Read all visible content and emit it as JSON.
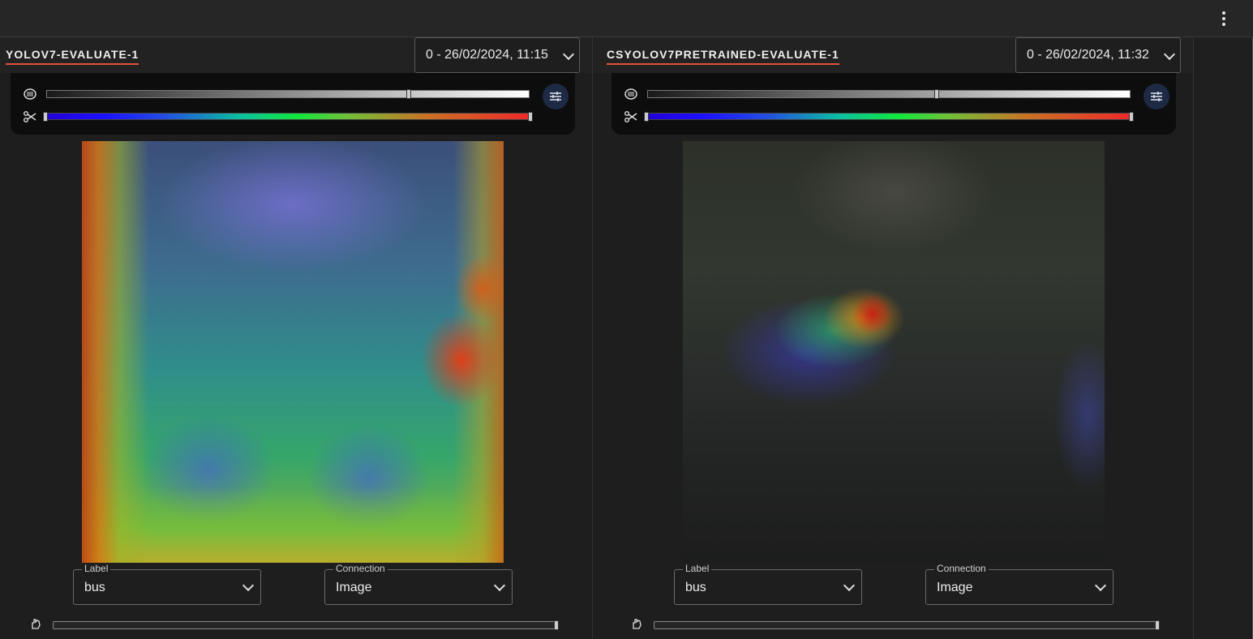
{
  "topbar": {
    "menu_icon": "more-vert-icon"
  },
  "panels": [
    {
      "title": "YOLOV7-EVALUATE-1",
      "run_selector": {
        "value": "0 - 26/02/2024, 11:15"
      },
      "opacity_slider": {
        "value_fraction": 0.75,
        "icon": "opacity-icon"
      },
      "threshold_slider": {
        "min_fraction": 0.0,
        "max_fraction": 1.0,
        "icon": "scissors-icon"
      },
      "settings_button": {
        "icon": "tune-icon"
      },
      "image": {
        "description_hidden": true,
        "overlay": "heatmap-wide"
      },
      "label_field": {
        "label": "Label",
        "value": "bus"
      },
      "connection_field": {
        "label": "Connection",
        "value": "Image"
      },
      "bottom_slider": {
        "value_fraction": 1.0,
        "icon": "pan-tool-icon"
      }
    },
    {
      "title": "CSYOLOV7PRETRAINED-EVALUATE-1",
      "run_selector": {
        "value": "0 - 26/02/2024, 11:32"
      },
      "opacity_slider": {
        "value_fraction": 0.6,
        "icon": "opacity-icon"
      },
      "threshold_slider": {
        "min_fraction": 0.0,
        "max_fraction": 1.0,
        "icon": "scissors-icon"
      },
      "settings_button": {
        "icon": "tune-icon"
      },
      "image": {
        "description_hidden": true,
        "overlay": "heatmap-focused"
      },
      "label_field": {
        "label": "Label",
        "value": "bus"
      },
      "connection_field": {
        "label": "Connection",
        "value": "Image"
      },
      "bottom_slider": {
        "value_fraction": 1.0,
        "icon": "pan-tool-icon"
      }
    }
  ],
  "colors": {
    "accent_underline": "#e0533a",
    "background": "#1e1e1e",
    "controls_bg": "#0d0d0d",
    "tune_button_bg": "#1e2a44"
  }
}
